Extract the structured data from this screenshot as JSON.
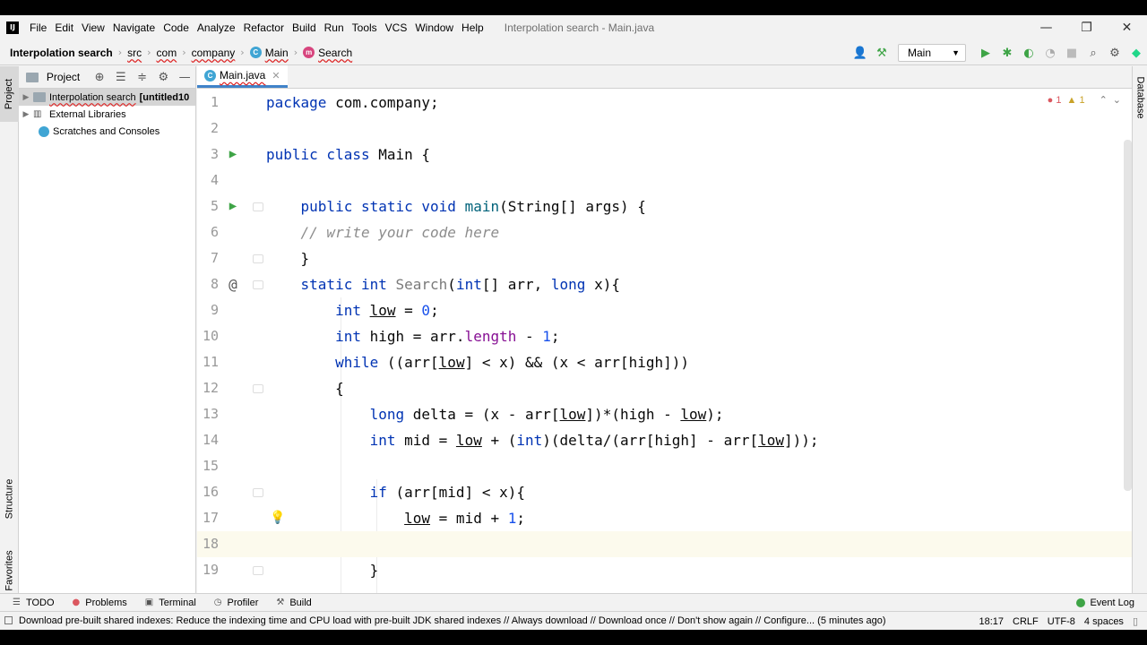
{
  "window": {
    "title": "Interpolation search - Main.java",
    "controls": {
      "minimize": "—",
      "restore": "❐",
      "close": "✕"
    }
  },
  "menu": [
    "File",
    "Edit",
    "View",
    "Navigate",
    "Code",
    "Analyze",
    "Refactor",
    "Build",
    "Run",
    "Tools",
    "VCS",
    "Window",
    "Help"
  ],
  "breadcrumb": {
    "project": "Interpolation search",
    "src": "src",
    "com": "com",
    "package": "company",
    "class": "Main",
    "method": "Search"
  },
  "run_config": {
    "selected": "Main"
  },
  "left_tabs": {
    "project": "Project",
    "structure": "Structure",
    "favorites": "Favorites"
  },
  "right_tabs": {
    "database": "Database"
  },
  "project_panel": {
    "title": "Project",
    "tree": [
      {
        "label": "Interpolation search",
        "suffix": "[untitled10",
        "selected": true
      },
      {
        "label": "External Libraries"
      },
      {
        "label": "Scratches and Consoles"
      }
    ]
  },
  "editor": {
    "tab": "Main.java",
    "inspection": {
      "errors": "1",
      "warnings": "1"
    },
    "line_numbers": [
      "1",
      "2",
      "3",
      "4",
      "5",
      "6",
      "7",
      "8",
      "9",
      "10",
      "11",
      "12",
      "13",
      "14",
      "15",
      "16",
      "17",
      "18",
      "19"
    ]
  },
  "bottom_tools": [
    "TODO",
    "Problems",
    "Terminal",
    "Profiler",
    "Build"
  ],
  "event_log": "Event Log",
  "status": {
    "message": "Download pre-built shared indexes: Reduce the indexing time and CPU load with pre-built JDK shared indexes // Always download // Download once // Don't show again // Configure... (5 minutes ago)",
    "position": "18:17",
    "line_sep": "CRLF",
    "encoding": "UTF-8",
    "indent": "4 spaces"
  },
  "colors": {
    "keyword": "#0033b3",
    "comment": "#8c8c8c",
    "number": "#1750eb",
    "field": "#871094",
    "current_line": "#fcfaed",
    "run_gutter": "#3ea446",
    "tab_underline": "#4083c9"
  }
}
